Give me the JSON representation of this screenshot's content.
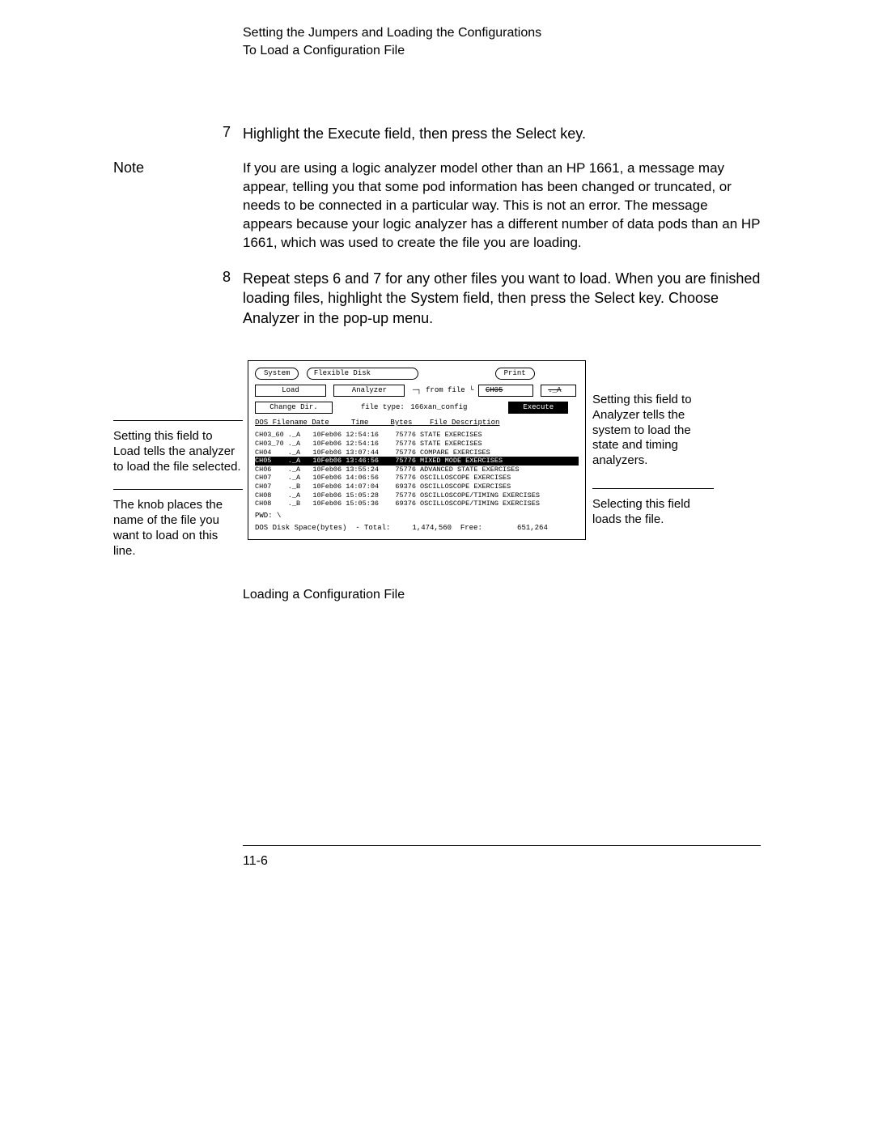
{
  "header": {
    "line1": "Setting the Jumpers and Loading the Configurations",
    "line2": "To Load a Configuration File"
  },
  "step7": {
    "num": "7",
    "pre": "Highlight the ",
    "code1": "Execute",
    "mid": " field, then press the ",
    "code2": "Select",
    "post": " key."
  },
  "note": {
    "label": "Note",
    "body": "If you are using a logic analyzer model other than an HP 1661, a message may appear, telling you that some pod information has been changed or truncated, or needs to be connected in a particular way.  This is not an error.  The message appears because your logic analyzer has a different number of data pods than an HP 1661, which was used to create the file you are loading."
  },
  "step8": {
    "num": "8",
    "pre": "Repeat steps 6 and 7 for any other files you want to load.  When you are finished loading files, highlight the ",
    "code1": "System",
    "mid": " field, then press the Select key.  Choose ",
    "code2": "Analyzer",
    "post": " in the pop-up menu."
  },
  "left": {
    "co1": "Setting this field to Load tells the analyzer to load the file selected.",
    "co2": "The knob places the name of the file you want to load on this line."
  },
  "right": {
    "co1": "Setting this field to Analyzer tells the system to load the state and timing analyzers.",
    "co2": "Selecting this field loads the file."
  },
  "ui": {
    "system": "System",
    "flexdisk": "Flexible Disk",
    "print": "Print",
    "load": "Load",
    "analyzer": "Analyzer",
    "fromfile": "from file",
    "ch05": "CH05",
    "ext": "._A",
    "changedir": "Change Dir.",
    "filetype_label": "file type:",
    "filetype_val": "166xan_config",
    "execute": "Execute",
    "colhdr": "DOS Filename Date     Time     Bytes    File Description",
    "rows": [
      "CH03_60 ._A   10Feb06 12:54:16    75776 STATE EXERCISES",
      "CH03_70 ._A   10Feb06 12:54:16    75776 STATE EXERCISES",
      "CH04    ._A   10Feb06 13:07:44    75776 COMPARE EXERCISES",
      "CH05    ._A   10Feb06 13:46:56    75776 MIXED MODE EXERCISES",
      "CH06    ._A   10Feb06 13:55:24    75776 ADVANCED STATE EXERCISES",
      "CH07    ._A   10Feb06 14:06:56    75776 OSCILLOSCOPE EXERCISES",
      "CH07    ._B   10Feb06 14:07:04    69376 OSCILLOSCOPE EXERCISES",
      "CH08    ._A   10Feb06 15:05:28    75776 OSCILLOSCOPE/TIMING EXERCISES",
      "CH08    ._B   10Feb06 15:05:36    69376 OSCILLOSCOPE/TIMING EXERCISES"
    ],
    "hlrow": 3,
    "pwd": "PWD: \\",
    "diskspace": "DOS Disk Space(bytes)  - Total:     1,474,560  Free:        651,264"
  },
  "caption": "Loading a Configuration File",
  "pagenum": "11-6"
}
